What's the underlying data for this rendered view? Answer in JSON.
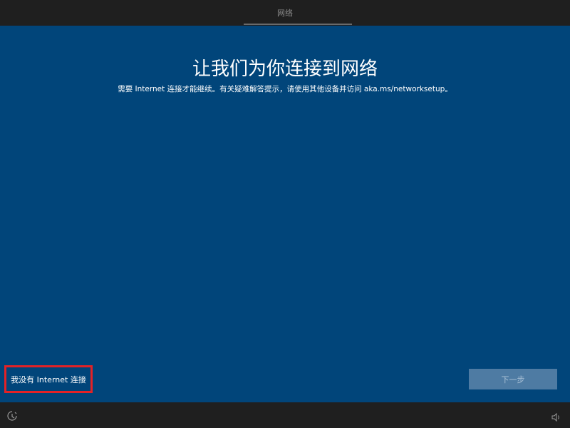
{
  "topbar": {
    "title": "网络"
  },
  "main": {
    "heading": "让我们为你连接到网络",
    "subtext": "需要 Internet 连接才能继续。有关疑难解答提示，请使用其他设备并访问 aka.ms/networksetup。",
    "no_internet_label": "我没有 Internet 连接",
    "next_label": "下一步"
  },
  "colors": {
    "background_blue": "#01457a",
    "highlight_red": "#e32226",
    "next_button_disabled": "#4e7ba3"
  },
  "icons": {
    "bottom_left": "ease-of-access-icon",
    "bottom_right": "volume-icon"
  }
}
